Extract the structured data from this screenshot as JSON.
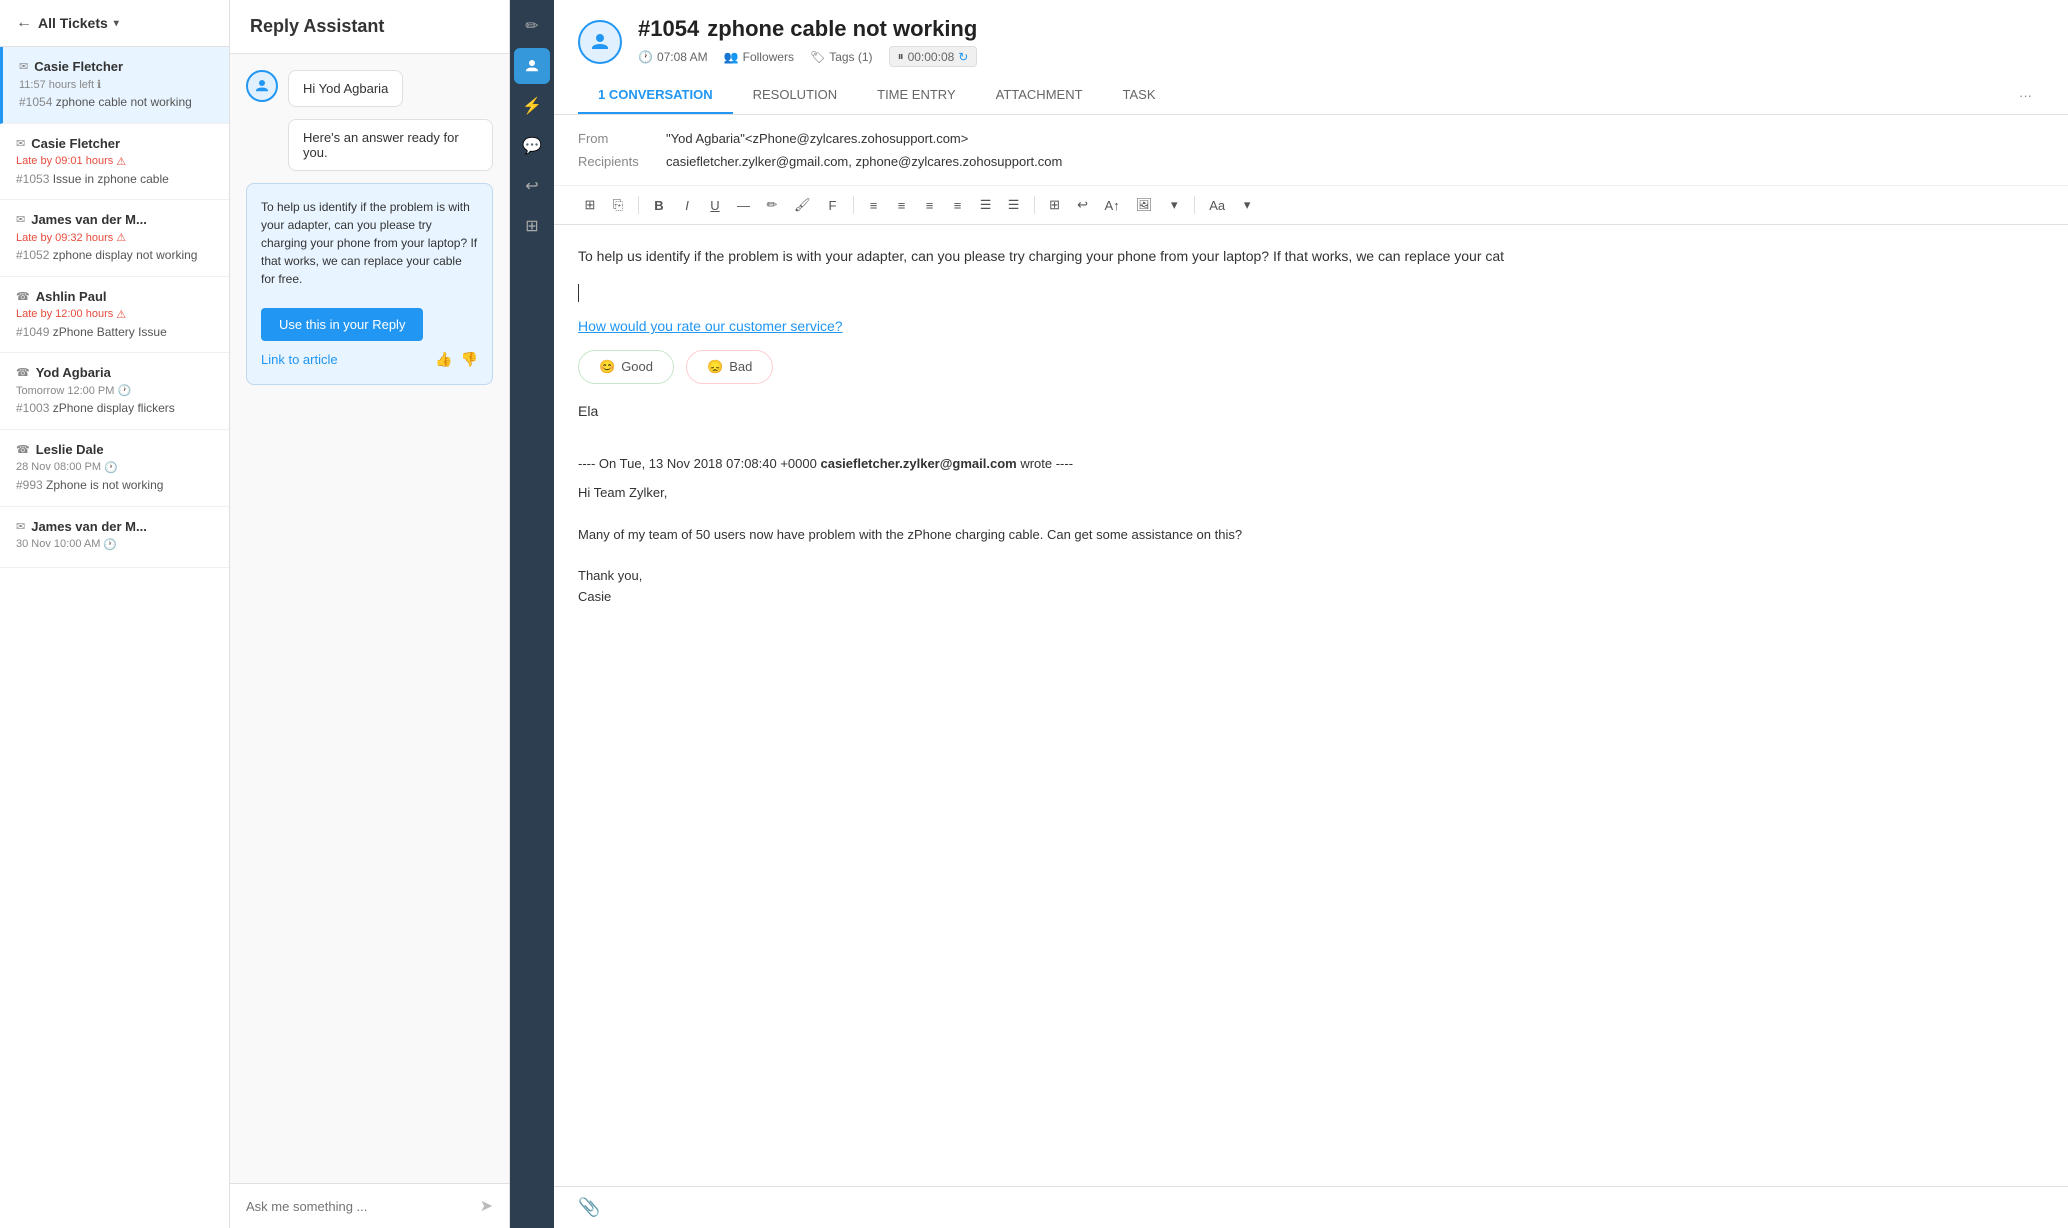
{
  "header": {
    "back_label": "All Tickets",
    "dropdown_icon": "▾"
  },
  "ticket_list": {
    "items": [
      {
        "id": 1,
        "icon": "✉",
        "contact": "Casie Fletcher",
        "time": "11:57 hours left",
        "time_icon": "ℹ",
        "ticket_num": "#1054",
        "subject": "zphone cable not working",
        "active": true,
        "overdue": false
      },
      {
        "id": 2,
        "icon": "✉",
        "contact": "Casie Fletcher",
        "time": "Late by 09:01 hours",
        "time_icon": "⚠",
        "ticket_num": "#1053",
        "subject": "Issue in zphone cable",
        "active": false,
        "overdue": true
      },
      {
        "id": 3,
        "icon": "✉",
        "contact": "James van der M...",
        "time": "Late by 09:32 hours",
        "time_icon": "⚠",
        "ticket_num": "#1052",
        "subject": "zphone display not working",
        "active": false,
        "overdue": true
      },
      {
        "id": 4,
        "icon": "☎",
        "contact": "Ashlin Paul",
        "time": "Late by 12:00 hours",
        "time_icon": "⚠",
        "ticket_num": "#1049",
        "subject": "zPhone Battery Issue",
        "active": false,
        "overdue": true
      },
      {
        "id": 5,
        "icon": "☎",
        "contact": "Yod Agbaria",
        "time": "Tomorrow 12:00 PM",
        "time_icon": "🕐",
        "ticket_num": "#1003",
        "subject": "zPhone display flickers",
        "active": false,
        "overdue": false
      },
      {
        "id": 6,
        "icon": "☎",
        "contact": "Leslie Dale",
        "time": "28 Nov 08:00 PM",
        "time_icon": "🕐",
        "ticket_num": "#993",
        "subject": "Zphone is not working",
        "active": false,
        "overdue": false
      },
      {
        "id": 7,
        "icon": "✉",
        "contact": "James van der M...",
        "time": "30 Nov 10:00 AM",
        "time_icon": "🕐",
        "ticket_num": "",
        "subject": "",
        "active": false,
        "overdue": false
      }
    ]
  },
  "reply_assistant": {
    "title": "Reply Assistant",
    "bot_greeting": "Hi Yod Agbaria",
    "bot_ready": "Here's an answer ready for you.",
    "answer_text": "To help us identify if the problem is with your adapter, can you please try charging your phone from your laptop? If that works, we can replace your cable for free.",
    "use_reply_btn": "Use this in your Reply",
    "link_to_article": "Link to article",
    "chat_placeholder": "Ask me something ..."
  },
  "icon_bar": {
    "items": [
      {
        "icon": "✏",
        "name": "edit-icon",
        "active": false
      },
      {
        "icon": "👤",
        "name": "agent-icon",
        "active": true
      },
      {
        "icon": "⚡",
        "name": "automation-icon",
        "active": false
      },
      {
        "icon": "💬",
        "name": "chat-icon",
        "active": false
      },
      {
        "icon": "↩",
        "name": "history-icon",
        "active": false
      },
      {
        "icon": "⊞",
        "name": "grid-icon",
        "active": false
      }
    ]
  },
  "ticket": {
    "number": "#1054",
    "title": "zphone cable not working",
    "time": "07:08 AM",
    "followers_label": "Followers",
    "tags_label": "Tags (1)",
    "timer": "00:00:08",
    "tabs": [
      {
        "label": "1 CONVERSATION",
        "count": "1",
        "active": true
      },
      {
        "label": "RESOLUTION",
        "active": false
      },
      {
        "label": "TIME ENTRY",
        "active": false
      },
      {
        "label": "ATTACHMENT",
        "active": false
      },
      {
        "label": "TASK",
        "active": false
      }
    ],
    "from_label": "From",
    "from_value": "\"Yod Agbaria\"<zPhone@zylcares.zohosupport.com>",
    "recipients_label": "Recipients",
    "recipients_value": "casiefletcher.zylker@gmail.com, zphone@zylcares.zohosupport.com"
  },
  "email_body": {
    "reply_text": "To help us identify if the problem is with your adapter, can you please try charging your phone from your laptop? If that works, we can replace your cat",
    "survey_link": "How would you rate our customer service?",
    "good_label": "Good",
    "bad_label": "Bad",
    "signature": "Ela",
    "original_intro": "---- On Tue, 13 Nov 2018 07:08:40 +0000",
    "original_sender": "casiefletcher.zylker@gmail.com",
    "original_wrote": "wrote ----",
    "original_greeting": "Hi Team Zylker,",
    "original_body": "Many of my team of 50 users now have problem with the zPhone charging cable. Can get some assistance on this?",
    "original_thanks": "Thank you,",
    "original_name": "Casie"
  },
  "toolbar": {
    "buttons": [
      "⊞",
      "⎘",
      "B",
      "I",
      "U",
      "—",
      "✏",
      "🖌",
      "F",
      "≡",
      "≡",
      "≡",
      "≡",
      "≡",
      "≡",
      "☰",
      "⊞",
      "↩",
      "A↑",
      "Aa",
      "▾"
    ]
  }
}
